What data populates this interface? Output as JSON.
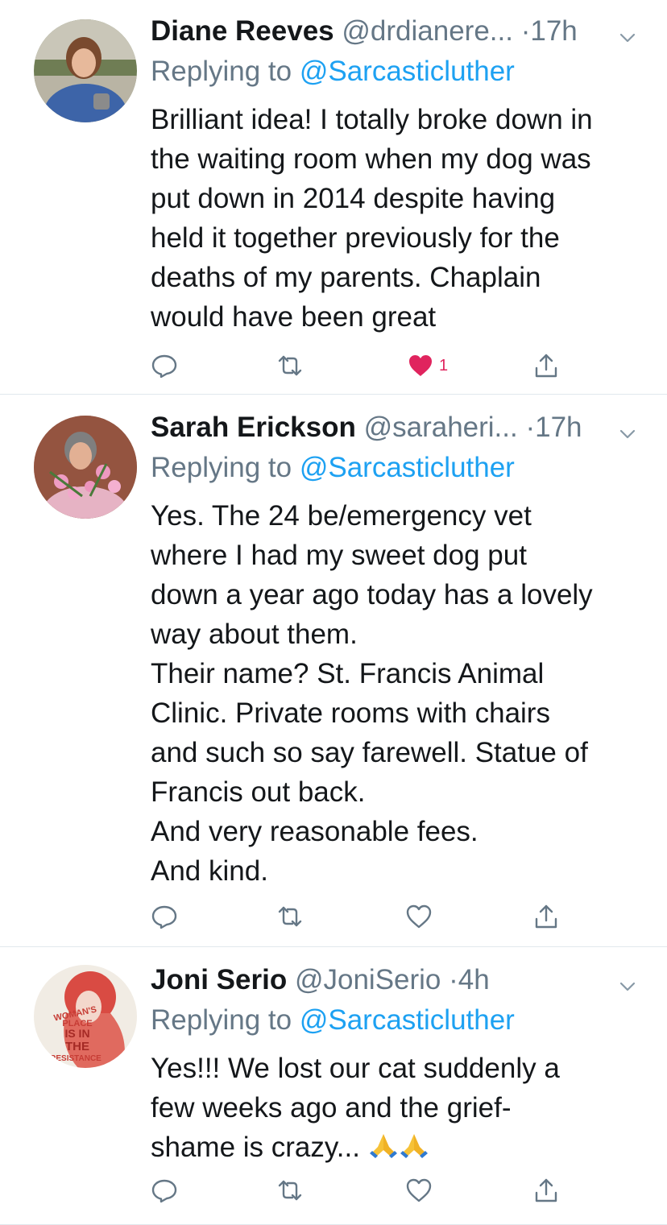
{
  "colors": {
    "accent": "#1da1f2",
    "secondary_text": "#657786",
    "like": "#e0245e",
    "divider": "#e1e8ed"
  },
  "tweets": [
    {
      "name": "Diane Reeves",
      "handle": "@drdianere...",
      "dot": "·",
      "time": "17h",
      "reply_prefix": "Replying to ",
      "reply_to": "@Sarcasticluther",
      "lines": [
        "Brilliant idea! I totally broke down in",
        "the waiting room when my dog was",
        "put down in 2014 despite having",
        "held it together previously for the",
        "deaths of my parents. Chaplain",
        "would have been great"
      ],
      "like_count": "1",
      "liked": true
    },
    {
      "name": "Sarah Erickson",
      "handle": "@saraheri...",
      "dot": "·",
      "time": "17h",
      "reply_prefix": "Replying to ",
      "reply_to": "@Sarcasticluther",
      "lines": [
        "Yes. The 24 be/emergency vet",
        "where I had my sweet dog put",
        "down a year ago today has a lovely",
        "way about them.",
        "Their name? St. Francis Animal",
        "Clinic. Private rooms with chairs",
        "and such so say farewell. Statue of",
        "Francis out back.",
        "And very reasonable fees.",
        "And kind."
      ],
      "like_count": "",
      "liked": false
    },
    {
      "name": "Joni Serio",
      "handle": "@JoniSerio",
      "dot": "·",
      "time": "4h",
      "reply_prefix": "Replying to ",
      "reply_to": "@Sarcasticluther",
      "lines": [
        "Yes!!! We lost our cat suddenly a",
        "few weeks ago and the grief-",
        "shame is crazy..."
      ],
      "like_count": "",
      "liked": false,
      "avatar_text": [
        "WOMAN'S",
        "PLACE",
        "IS IN",
        "THE",
        "RESISTANCE"
      ]
    }
  ]
}
